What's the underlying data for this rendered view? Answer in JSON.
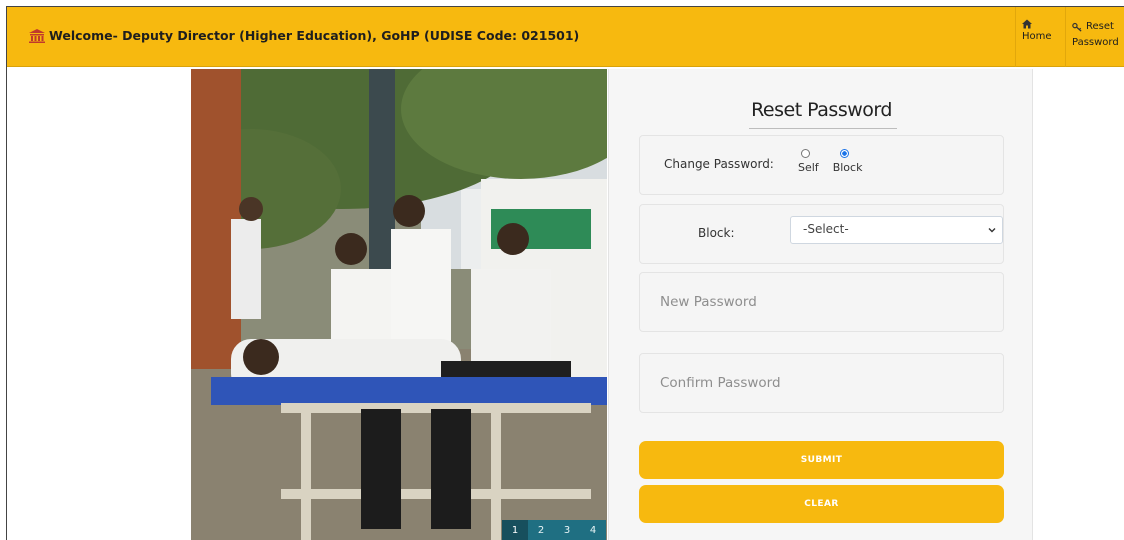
{
  "navbar": {
    "brand_text": "Welcome- Deputy Director (Higher Education), GoHP (UDISE Code: 021501)",
    "brand_icon": "bank-icon",
    "home_label": "Home",
    "home_icon": "home-icon",
    "reset_label_line1": "Reset",
    "reset_label_line2": "Password",
    "reset_icon": "key-icon"
  },
  "carousel": {
    "pages": [
      "1",
      "2",
      "3",
      "4"
    ],
    "active_page": "1"
  },
  "form": {
    "title": "Reset Password",
    "change_password_label": "Change Password:",
    "radio_options": [
      {
        "label": "Self",
        "checked": false
      },
      {
        "label": "Block",
        "checked": true
      }
    ],
    "block_label": "Block:",
    "block_select_value": "-Select-",
    "new_password_placeholder": "New Password",
    "confirm_password_placeholder": "Confirm Password",
    "submit_label": "SUBMIT",
    "clear_label": "CLEAR"
  },
  "colors": {
    "accent": "#f7b90f",
    "pager": "#1f6f82",
    "brand_icon": "#c0392b"
  }
}
